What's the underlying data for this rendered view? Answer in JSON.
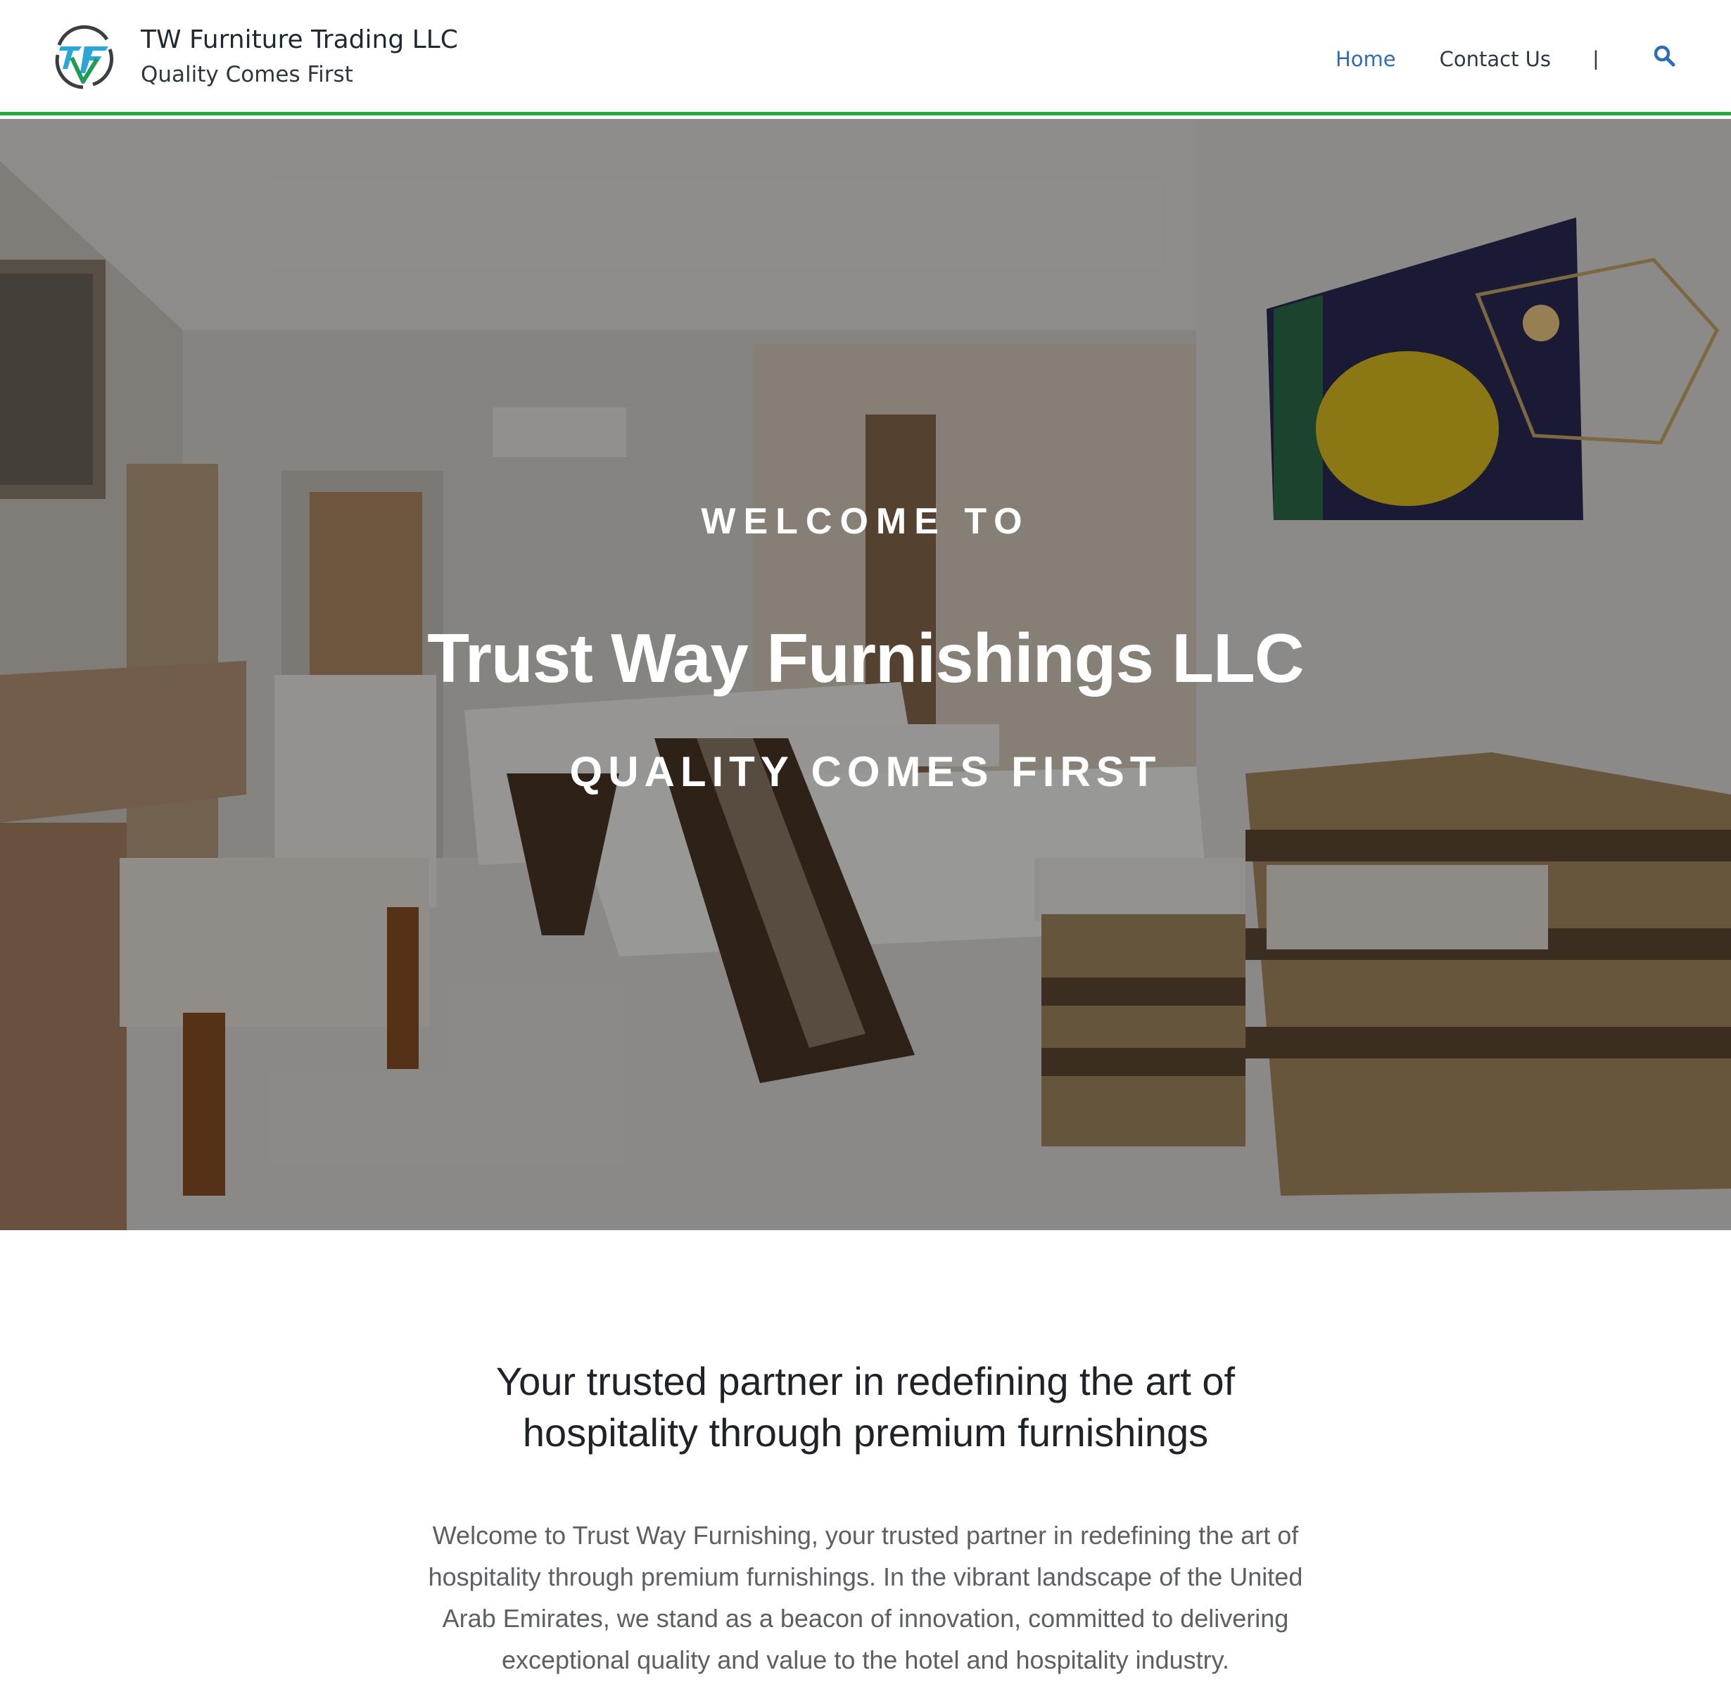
{
  "header": {
    "brand_name": "TW Furniture Trading LLC",
    "brand_tagline": "Quality Comes First",
    "logo_icon": "tw-logo-icon",
    "nav": {
      "home": "Home",
      "contact": "Contact Us",
      "separator": "|"
    },
    "search_icon": "search-icon",
    "accent_color": "#23a93a",
    "link_color": "#2f6db3"
  },
  "hero": {
    "kicker": "WELCOME TO",
    "title": "Trust Way Furnishings LLC",
    "subtitle": "QUALITY COMES FIRST"
  },
  "intro": {
    "heading": "Your trusted partner in redefining the art of hospitality through premium furnishings",
    "body": "Welcome to Trust Way Furnishing, your trusted partner in redefining the art of hospitality through premium furnishings. In the vibrant landscape of the United Arab Emirates, we stand as a beacon of innovation, committed to delivering exceptional quality and value to the hotel and hospitality industry."
  }
}
